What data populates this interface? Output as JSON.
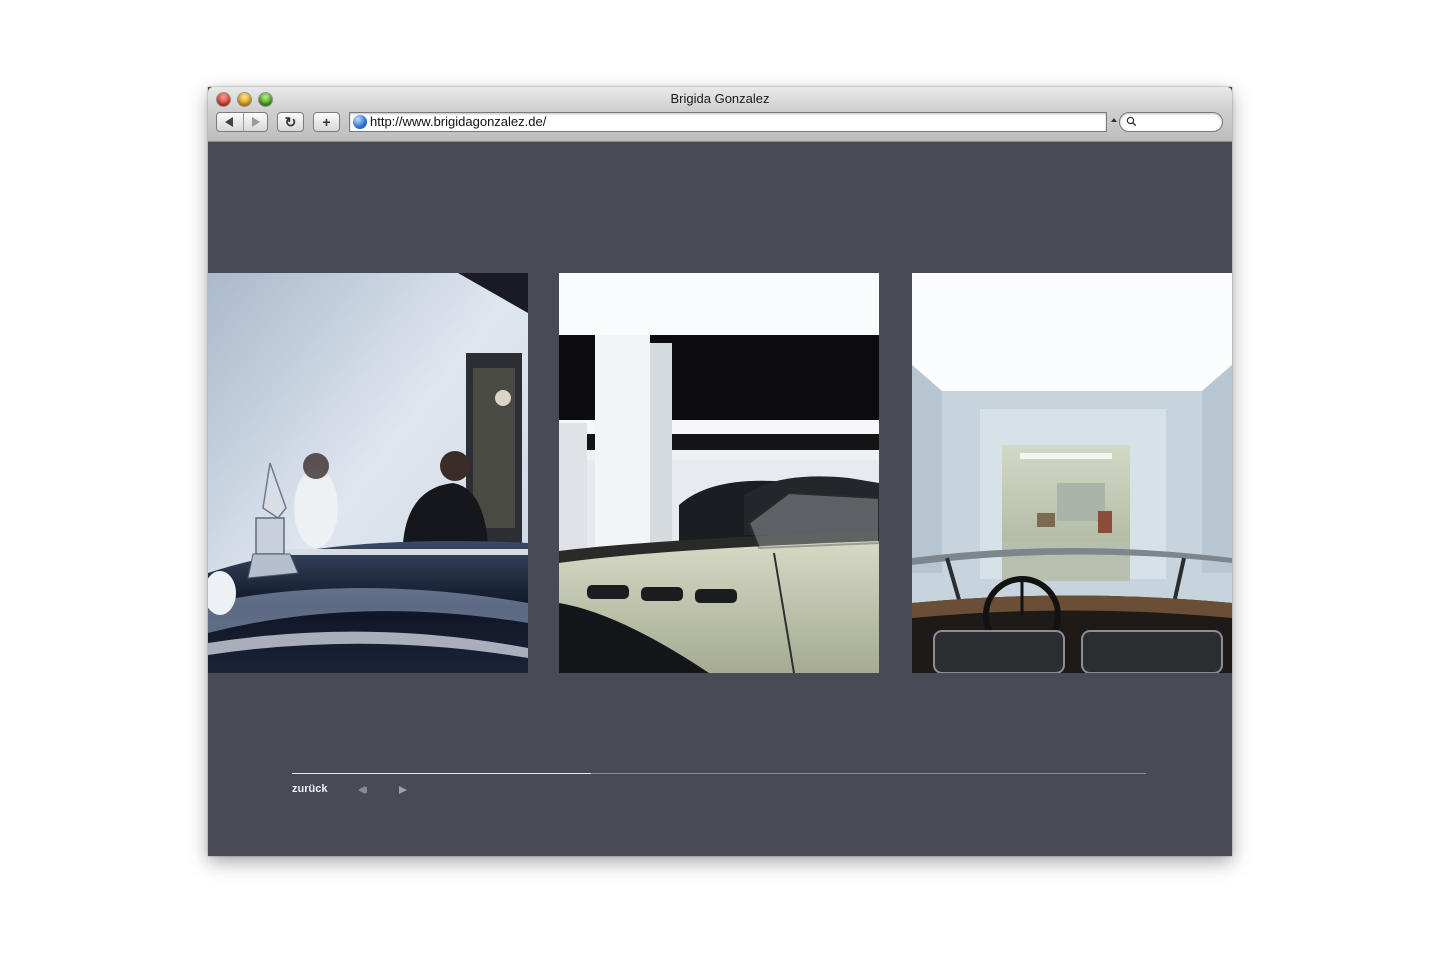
{
  "window": {
    "title": "Brigida Gonzalez",
    "url": "http://www.brigidagonzalez.de/"
  },
  "toolbar": {
    "reload_glyph": "↻",
    "add_glyph": "+"
  },
  "gallery": {
    "photos": [
      {
        "subject": "car hood ornament with two men looking at a painting"
      },
      {
        "subject": "vintage convertible cars in white hall with columns"
      },
      {
        "subject": "view over convertible dashboard into corridor"
      }
    ],
    "progress": 0.35,
    "back_label": "zurück"
  },
  "colors": {
    "page_bg": "#4a4a56",
    "accent": "#f0f0f4"
  }
}
